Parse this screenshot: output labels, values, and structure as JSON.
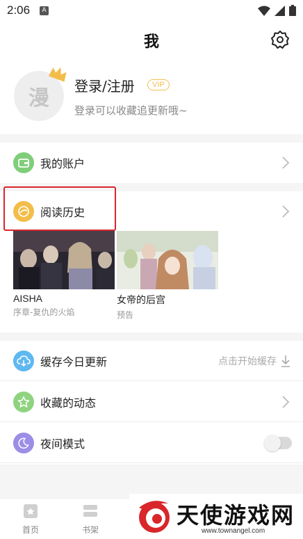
{
  "status_bar": {
    "time": "2:06",
    "notification_badge": "A"
  },
  "header": {
    "title": "我"
  },
  "profile": {
    "avatar_char": "漫",
    "login_label": "登录/注册",
    "vip_badge": "VIP",
    "subtitle": "登录可以收藏追更新哦~"
  },
  "menu": {
    "account": {
      "label": "我的账户",
      "icon": "wallet-icon",
      "color": "#7fce79"
    },
    "history": {
      "label": "阅读历史",
      "icon": "clock-icon",
      "color": "#f3bd4a"
    },
    "cache": {
      "label": "缓存今日更新",
      "hint": "点击开始缓存",
      "icon": "cloud-download-icon",
      "color": "#5fb8f0"
    },
    "favorites": {
      "label": "收藏的动态",
      "icon": "star-icon",
      "color": "#8fd37f"
    },
    "night": {
      "label": "夜间模式",
      "icon": "moon-icon",
      "color": "#9c8ee6",
      "enabled": false
    }
  },
  "history_items": [
    {
      "title": "AISHA",
      "subtitle": "序章-复仇的火焰"
    },
    {
      "title": "女帝的后宫",
      "subtitle": "预告"
    }
  ],
  "bottom_nav": [
    {
      "label": "首页",
      "icon": "home-icon"
    },
    {
      "label": "书架",
      "icon": "bookshelf-icon"
    }
  ],
  "watermark": {
    "text": "天使游戏网",
    "url": "www.townangel.com"
  },
  "colors": {
    "highlight": "#d8262a",
    "vip": "#f1c04f"
  }
}
